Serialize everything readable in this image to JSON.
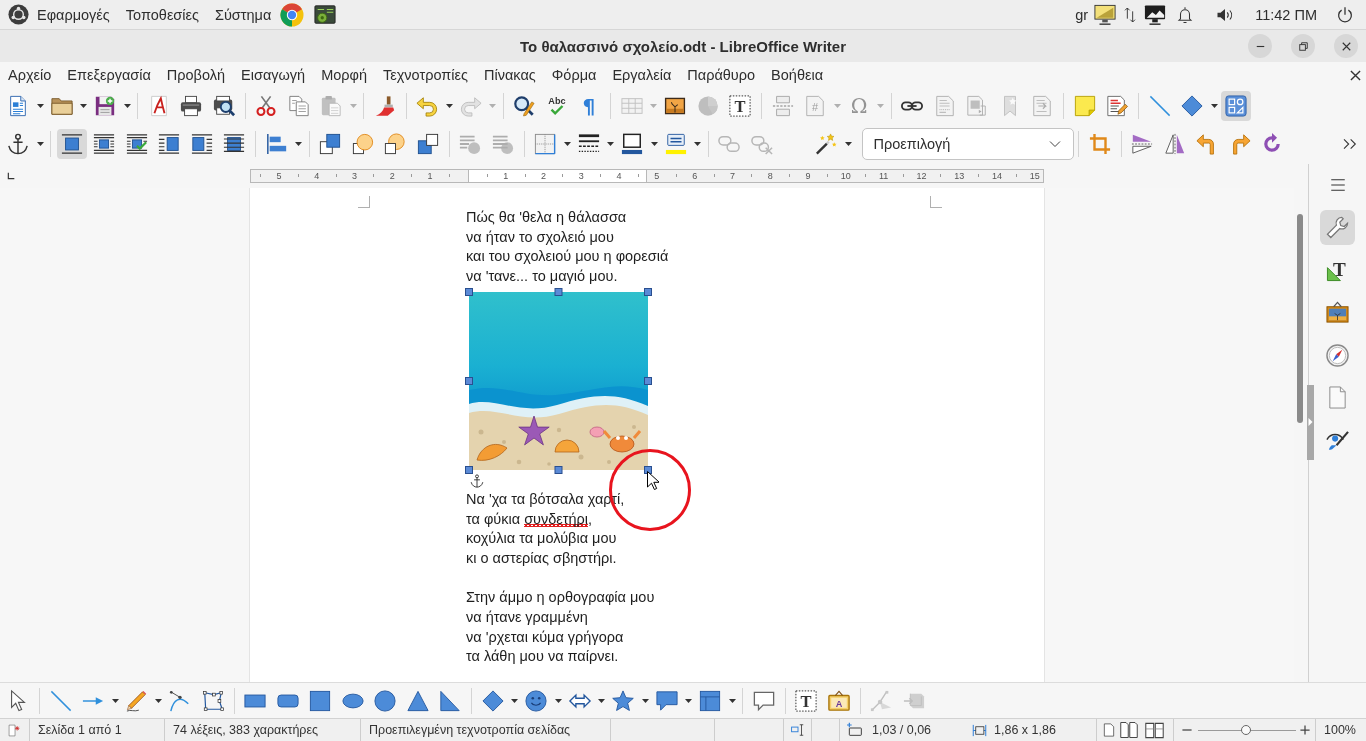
{
  "top_panel": {
    "menus": [
      "Εφαρμογές",
      "Τοποθεσίες",
      "Σύστημα"
    ],
    "keyboard_layout": "gr",
    "clock": "11:42 ΠΜ"
  },
  "window": {
    "title": "Το θαλασσινό σχολείο.odt - LibreOffice Writer"
  },
  "menu_bar": [
    "Αρχείο",
    "Επεξεργασία",
    "Προβολή",
    "Εισαγωγή",
    "Μορφή",
    "Τεχνοτροπίες",
    "Πίνακας",
    "Φόρμα",
    "Εργαλεία",
    "Παράθυρο",
    "Βοήθεια"
  ],
  "standard_toolbar": [
    {
      "disabled": false,
      "pressed": false
    },
    {
      "disabled": false,
      "pressed": false
    },
    {
      "disabled": false,
      "pressed": false
    },
    {
      "disabled": false,
      "pressed": false
    },
    {
      "disabled": false,
      "pressed": false
    },
    {
      "disabled": false,
      "pressed": false
    },
    {
      "disabled": false,
      "pressed": false
    },
    {
      "disabled": false,
      "pressed": false
    },
    {
      "disabled": true,
      "pressed": false
    },
    {
      "disabled": false,
      "pressed": false
    },
    {
      "disabled": false,
      "pressed": false
    },
    {
      "disabled": true,
      "pressed": false
    },
    {
      "disabled": false,
      "pressed": false
    },
    {
      "glyph": "Abc",
      "disabled": false,
      "pressed": false
    },
    {
      "glyph": "¶",
      "disabled": false,
      "pressed": false
    },
    {
      "disabled": true,
      "pressed": false
    },
    {
      "disabled": false,
      "pressed": false
    },
    {
      "disabled": true,
      "pressed": false
    },
    {
      "glyph": "T",
      "disabled": false,
      "pressed": false
    },
    {
      "disabled": true,
      "pressed": false
    },
    {
      "glyph": "#",
      "disabled": true,
      "pressed": false
    },
    {
      "glyph": "Ω",
      "disabled": true,
      "pressed": false
    },
    {
      "disabled": false,
      "pressed": false
    },
    {
      "disabled": true,
      "pressed": false
    },
    {
      "disabled": true,
      "pressed": false
    },
    {
      "disabled": true,
      "pressed": false
    },
    {
      "disabled": true,
      "pressed": false
    },
    {
      "disabled": false,
      "pressed": false
    },
    {
      "disabled": false,
      "pressed": false
    },
    {
      "disabled": false,
      "pressed": false
    },
    {
      "disabled": false,
      "pressed": false
    },
    {
      "disabled": false,
      "pressed": true
    }
  ],
  "frame_toolbar": {
    "buttons": [
      {
        "disabled": false,
        "pressed": false
      },
      {
        "disabled": false,
        "pressed": true
      },
      {
        "disabled": false,
        "pressed": false
      },
      {
        "disabled": false,
        "pressed": false
      },
      {
        "disabled": false,
        "pressed": false
      },
      {
        "disabled": false,
        "pressed": false
      },
      {
        "disabled": false,
        "pressed": false
      },
      {
        "disabled": false,
        "pressed": false
      },
      {
        "disabled": false,
        "pressed": false
      },
      {
        "disabled": false,
        "pressed": false
      },
      {
        "disabled": false,
        "pressed": false
      },
      {
        "disabled": false,
        "pressed": false
      },
      {
        "disabled": true,
        "pressed": false
      },
      {
        "disabled": true,
        "pressed": false
      },
      {
        "disabled": false,
        "pressed": false
      },
      {
        "disabled": false,
        "pressed": false
      },
      {
        "disabled": false,
        "pressed": false
      },
      {
        "disabled": false,
        "pressed": false
      },
      {
        "disabled": true,
        "pressed": false
      },
      {
        "disabled": true,
        "pressed": false
      },
      {
        "disabled": false,
        "pressed": false
      },
      {
        "disabled": false,
        "pressed": false
      },
      {
        "disabled": false,
        "pressed": false
      },
      {
        "disabled": false,
        "pressed": false
      },
      {
        "disabled": false,
        "pressed": false
      },
      {
        "disabled": false,
        "pressed": false
      },
      {
        "disabled": false,
        "pressed": false
      }
    ],
    "style_box": {
      "value": "Προεπιλογή"
    }
  },
  "ruler": {
    "left_labels": [
      "5",
      "4",
      "3",
      "2",
      "1"
    ],
    "right_labels": [
      "1",
      "2",
      "3",
      "4",
      "5",
      "6",
      "7",
      "8",
      "9",
      "10",
      "11",
      "12",
      "13",
      "14",
      "15"
    ]
  },
  "document": {
    "blocks": [
      {
        "kind": "stanza",
        "selected": false,
        "lines": [
          [
            {
              "text": "Πώς θα 'θελα η θάλασσα",
              "misspelled": false
            }
          ],
          [
            {
              "text": "να ήταν το σχολειό μου",
              "misspelled": false
            }
          ],
          [
            {
              "text": "και του σχολειού μου η φορεσιά",
              "misspelled": false
            }
          ],
          [
            {
              "text": "να 'τανε... το μαγιό μου.",
              "misspelled": false
            }
          ]
        ]
      },
      {
        "kind": "image",
        "selected": true
      },
      {
        "kind": "stanza",
        "selected": false,
        "lines": [
          [
            {
              "text": "Να 'χα τα βότσαλα χαρτί,",
              "misspelled": false
            }
          ],
          [
            {
              "text": "τα φύκια ",
              "misspelled": false
            },
            {
              "text": "συνδετήρι",
              "misspelled": true
            },
            {
              "text": ",",
              "misspelled": false
            }
          ],
          [
            {
              "text": "κοχύλια τα μολύβια μου",
              "misspelled": false
            }
          ],
          [
            {
              "text": "κι ο αστερίας σβηστήρι.",
              "misspelled": false
            }
          ]
        ]
      },
      {
        "kind": "stanza",
        "selected": false,
        "lines": [
          [
            {
              "text": "Στην άμμο η ορθογραφία μου",
              "misspelled": false
            }
          ],
          [
            {
              "text": "να ήτανε γραμμένη",
              "misspelled": false
            }
          ],
          [
            {
              "text": "να 'ρχεται κύμα γρήγορα",
              "misspelled": false
            }
          ],
          [
            {
              "text": "τα λάθη μου να παίρνει.",
              "misspelled": false
            }
          ]
        ]
      }
    ]
  },
  "pointer": {
    "highlight_ring": true
  },
  "sidebar": {
    "tabs": [
      {
        "selected": true
      },
      {
        "glyph": "T",
        "selected": false
      },
      {
        "selected": false
      },
      {
        "selected": false
      },
      {
        "selected": false
      },
      {
        "selected": false
      }
    ]
  },
  "drawing_toolbar": [
    {
      "disabled": false,
      "pressed": false
    },
    {
      "disabled": false,
      "pressed": false
    },
    {
      "disabled": false,
      "pressed": false
    },
    {
      "disabled": false,
      "pressed": false
    },
    {
      "disabled": false,
      "pressed": false
    },
    {
      "disabled": false,
      "pressed": false
    },
    {
      "disabled": false,
      "pressed": false
    },
    {
      "disabled": false,
      "pressed": false
    },
    {
      "disabled": false,
      "pressed": false
    },
    {
      "disabled": false,
      "pressed": false
    },
    {
      "disabled": false,
      "pressed": false
    },
    {
      "disabled": false,
      "pressed": false
    },
    {
      "disabled": false,
      "pressed": false
    },
    {
      "disabled": false,
      "pressed": false
    },
    {
      "disabled": false,
      "pressed": false
    },
    {
      "disabled": false,
      "pressed": false
    },
    {
      "disabled": false,
      "pressed": false
    },
    {
      "disabled": false,
      "pressed": false
    },
    {
      "disabled": false,
      "pressed": false
    },
    {
      "disabled": false,
      "pressed": false
    },
    {
      "glyph": "T",
      "disabled": false,
      "pressed": false
    },
    {
      "glyph": "A",
      "disabled": false,
      "pressed": false
    },
    {
      "disabled": true,
      "pressed": false
    },
    {
      "disabled": true,
      "pressed": false
    }
  ],
  "status_bar": {
    "page": "Σελίδα 1 από 1",
    "words": "74 λέξεις, 383 χαρακτήρες",
    "page_style": "Προεπιλεγμένη τεχνοτροπία σελίδας",
    "position": "1,03 / 0,06",
    "size": "1,86 x 1,86",
    "zoom": {
      "level": 0.49,
      "reading": "100%"
    }
  }
}
